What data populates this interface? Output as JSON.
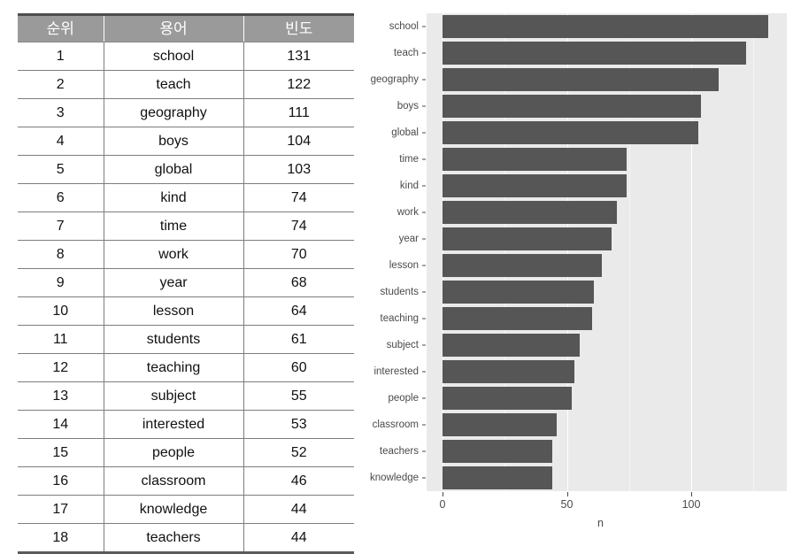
{
  "table": {
    "headers": [
      "순위",
      "용어",
      "빈도"
    ],
    "rows": [
      {
        "rank": "1",
        "term": "school",
        "freq": "131"
      },
      {
        "rank": "2",
        "term": "teach",
        "freq": "122"
      },
      {
        "rank": "3",
        "term": "geography",
        "freq": "111"
      },
      {
        "rank": "4",
        "term": "boys",
        "freq": "104"
      },
      {
        "rank": "5",
        "term": "global",
        "freq": "103"
      },
      {
        "rank": "6",
        "term": "kind",
        "freq": "74"
      },
      {
        "rank": "7",
        "term": "time",
        "freq": "74"
      },
      {
        "rank": "8",
        "term": "work",
        "freq": "70"
      },
      {
        "rank": "9",
        "term": "year",
        "freq": "68"
      },
      {
        "rank": "10",
        "term": "lesson",
        "freq": "64"
      },
      {
        "rank": "11",
        "term": "students",
        "freq": "61"
      },
      {
        "rank": "12",
        "term": "teaching",
        "freq": "60"
      },
      {
        "rank": "13",
        "term": "subject",
        "freq": "55"
      },
      {
        "rank": "14",
        "term": "interested",
        "freq": "53"
      },
      {
        "rank": "15",
        "term": "people",
        "freq": "52"
      },
      {
        "rank": "16",
        "term": "classroom",
        "freq": "46"
      },
      {
        "rank": "17",
        "term": "knowledge",
        "freq": "44"
      },
      {
        "rank": "18",
        "term": "teachers",
        "freq": "44"
      }
    ]
  },
  "chart_data": {
    "type": "bar",
    "orientation": "horizontal",
    "title": "",
    "xlabel": "n",
    "ylabel": "",
    "xlim": [
      0,
      138
    ],
    "xticks": [
      0,
      50,
      100
    ],
    "xtick_labels": [
      "0",
      "50",
      "100"
    ],
    "grid": true,
    "legend": "none",
    "bar_color": "#565656",
    "panel_color": "#eaeaea",
    "gridline_color": "#ffffff",
    "categories": [
      "school",
      "teach",
      "geography",
      "boys",
      "global",
      "time",
      "kind",
      "work",
      "year",
      "lesson",
      "students",
      "teaching",
      "subject",
      "interested",
      "people",
      "classroom",
      "teachers",
      "knowledge"
    ],
    "values": [
      131,
      122,
      111,
      104,
      103,
      74,
      74,
      70,
      68,
      64,
      61,
      60,
      55,
      53,
      52,
      46,
      44,
      44
    ]
  }
}
